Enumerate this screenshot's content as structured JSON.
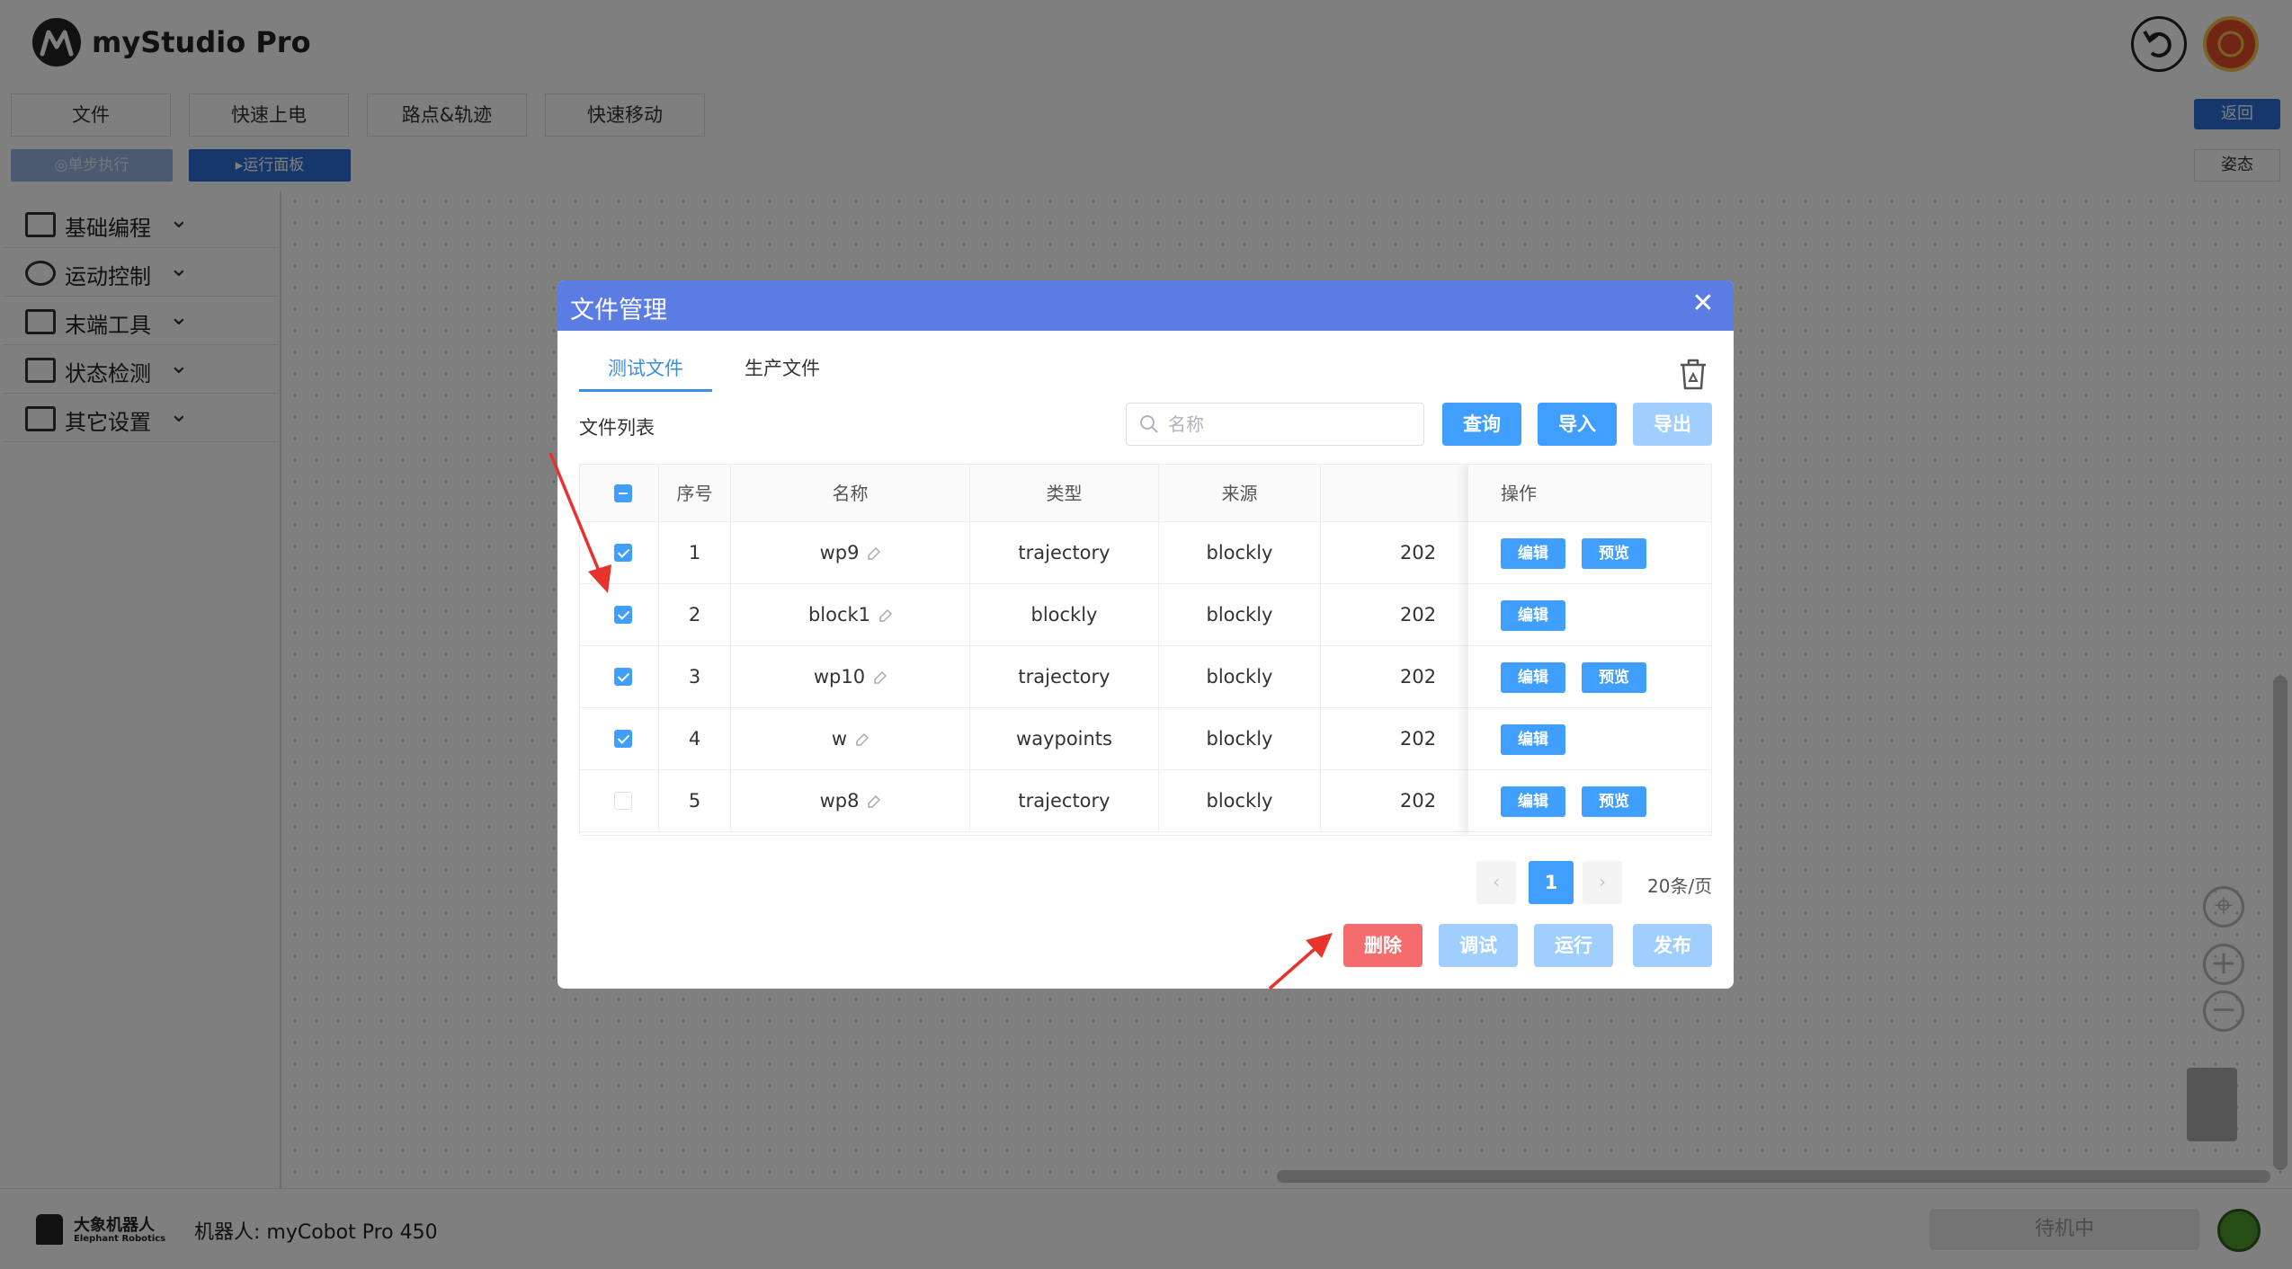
{
  "app": {
    "title": "myStudio Pro",
    "menu": [
      "文件",
      "快速上电",
      "路点&轨迹",
      "快速移动"
    ],
    "back_label": "返回",
    "step_label": "◎单步执行",
    "run_panel_label": "▸运行面板",
    "pose_label": "姿态",
    "sidebar": [
      {
        "label": "基础编程",
        "icon": "block-icon"
      },
      {
        "label": "运动控制",
        "icon": "joystick-icon"
      },
      {
        "label": "末端工具",
        "icon": "tool-icon"
      },
      {
        "label": "状态检测",
        "icon": "monitor-icon"
      },
      {
        "label": "其它设置",
        "icon": "settings-flag-icon"
      }
    ],
    "footer": {
      "brand_cn": "大象机器人",
      "brand_en": "Elephant Robotics",
      "robot_info": "机器人: myCobot Pro 450",
      "status_label": "待机中"
    }
  },
  "dialog": {
    "title": "文件管理",
    "tabs": [
      "测试文件",
      "生产文件"
    ],
    "active_tab": "测试文件",
    "list_label": "文件列表",
    "search_placeholder": "名称",
    "query_label": "查询",
    "import_label": "导入",
    "export_label": "导出",
    "columns": [
      "序号",
      "名称",
      "类型",
      "来源",
      "操作"
    ],
    "rows": [
      {
        "index": "1",
        "name": "wp9",
        "type": "trajectory",
        "source": "blockly",
        "date": "202",
        "checked": true,
        "actions": [
          "编辑",
          "预览"
        ]
      },
      {
        "index": "2",
        "name": "block1",
        "type": "blockly",
        "source": "blockly",
        "date": "202",
        "checked": true,
        "actions": [
          "编辑"
        ]
      },
      {
        "index": "3",
        "name": "wp10",
        "type": "trajectory",
        "source": "blockly",
        "date": "202",
        "checked": true,
        "actions": [
          "编辑",
          "预览"
        ]
      },
      {
        "index": "4",
        "name": "w",
        "type": "waypoints",
        "source": "blockly",
        "date": "202",
        "checked": true,
        "actions": [
          "编辑"
        ]
      },
      {
        "index": "5",
        "name": "wp8",
        "type": "trajectory",
        "source": "blockly",
        "date": "202",
        "checked": false,
        "actions": [
          "编辑",
          "预览"
        ]
      }
    ],
    "pagination": {
      "current_page": "1",
      "page_size": "20条/页"
    },
    "footer_buttons": {
      "delete": "删除",
      "debug": "调试",
      "run": "运行",
      "publish": "发布"
    }
  },
  "colors": {
    "header_blue": "#5a7ce3",
    "primary": "#409eff",
    "primary_disabled": "#a0cfff",
    "danger": "#f56c6c",
    "annotation_red": "#e8332c"
  }
}
